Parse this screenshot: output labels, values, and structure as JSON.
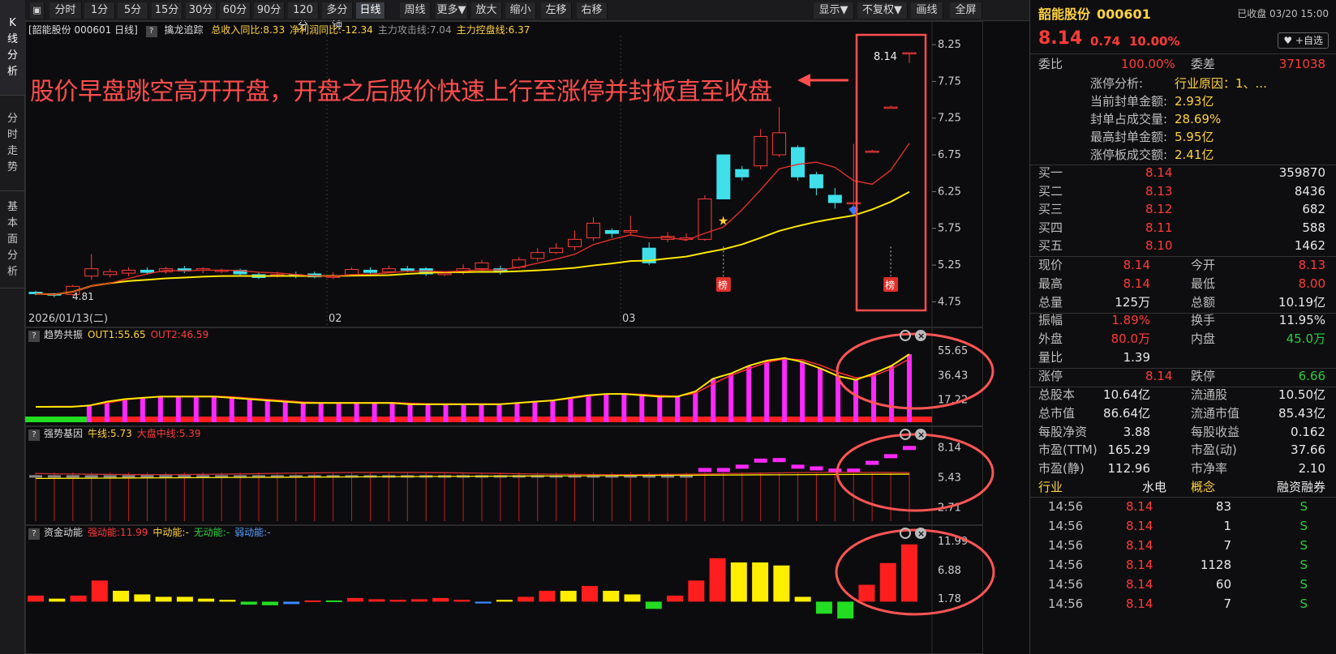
{
  "nav": {
    "kline": "K线分析",
    "fenshi": "分时走势",
    "jiben": "基本面分析"
  },
  "toolbar": {
    "periods": [
      "分时",
      "1分",
      "5分",
      "15分",
      "30分",
      "60分",
      "90分",
      "120分",
      "多分钟",
      "日线",
      "周线",
      "更多▼",
      "放大",
      "缩小",
      "左移",
      "右移"
    ],
    "active": "日线",
    "right": [
      "显示▼",
      "不复权▼",
      "画线",
      "全屏"
    ]
  },
  "kchart": {
    "stock": "[韶能股份 000601 日线]",
    "indicator": "擒龙追踪",
    "vals": [
      {
        "t": "总收入同比:8.33",
        "c": "#ffd23f"
      },
      {
        "t": "净利润同比:-12.34",
        "c": "#ffd23f"
      },
      {
        "t": "主力攻击线:7.04",
        "c": "#9a9a9a"
      },
      {
        "t": "主力控盘线:6.37",
        "c": "#ffd23f"
      }
    ],
    "annotation": "股价早盘跳空高开开盘，开盘之后股价快速上行至涨停并封板直至收盘",
    "last_price": "8.14",
    "low_label": "4.81",
    "bang": "榜",
    "y_ticks": [
      "8.25",
      "7.75",
      "7.25",
      "6.75",
      "6.25",
      "5.75",
      "5.25",
      "4.75"
    ],
    "x_labels": [
      "2026/01/13(二)",
      "02",
      "03"
    ]
  },
  "panel1": {
    "name": "趋势共振",
    "vals": [
      {
        "t": "OUT1:55.65",
        "c": "#ffd23f"
      },
      {
        "t": "OUT2:46.59",
        "c": "#ff3b3b"
      }
    ],
    "y_ticks": [
      "55.65",
      "36.43",
      "17.22"
    ]
  },
  "panel2": {
    "name": "强势基因",
    "vals": [
      {
        "t": "牛线:5.73",
        "c": "#ffd23f"
      },
      {
        "t": "大盘中线:5.39",
        "c": "#ff3b3b"
      }
    ],
    "y_ticks": [
      "8.14",
      "5.43",
      "2.71"
    ]
  },
  "panel3": {
    "name": "资金动能",
    "vals": [
      {
        "t": "强动能:11.99",
        "c": "#ff3b3b"
      },
      {
        "t": "中动能:-",
        "c": "#ffd23f"
      },
      {
        "t": "无动能:-",
        "c": "#2ecc40"
      },
      {
        "t": "弱动能:-",
        "c": "#5aa0ff"
      }
    ],
    "y_ticks": [
      "11.99",
      "6.88",
      "1.78"
    ]
  },
  "side": {
    "name": "韶能股份",
    "code": "000601",
    "status": "已收盘 03/20 15:00",
    "price": "8.14",
    "change": "0.74",
    "pct": "10.00%",
    "fav": "♥ +自选",
    "weibi": {
      "label": "委比",
      "value": "100.00%",
      "label2": "委差",
      "value2": "371038"
    },
    "limit_info": [
      {
        "k": "涨停分析:",
        "v": "行业原因：1、..."
      },
      {
        "k": "当前封单金额:",
        "v": "2.93亿"
      },
      {
        "k": "封单占成交量:",
        "v": "28.69%"
      },
      {
        "k": "最高封单金额:",
        "v": "5.95亿"
      },
      {
        "k": "涨停板成交额:",
        "v": "2.41亿"
      }
    ],
    "buy": [
      {
        "l": "买一",
        "p": "8.14",
        "v": "359870"
      },
      {
        "l": "买二",
        "p": "8.13",
        "v": "8436"
      },
      {
        "l": "买三",
        "p": "8.12",
        "v": "682"
      },
      {
        "l": "买四",
        "p": "8.11",
        "v": "588"
      },
      {
        "l": "买五",
        "p": "8.10",
        "v": "1462"
      }
    ],
    "quote": [
      {
        "a": "现价",
        "b": "8.14",
        "bc": "red",
        "c": "今开",
        "d": "8.13",
        "dc": "red"
      },
      {
        "a": "最高",
        "b": "8.14",
        "bc": "red",
        "c": "最低",
        "d": "8.00",
        "dc": "red"
      },
      {
        "a": "总量",
        "b": "125万",
        "bc": "wht",
        "c": "总额",
        "d": "10.19亿",
        "dc": "wht"
      }
    ],
    "quote2": [
      {
        "a": "振幅",
        "b": "1.89%",
        "bc": "red",
        "c": "换手",
        "d": "11.95%",
        "dc": "wht"
      },
      {
        "a": "外盘",
        "b": "80.0万",
        "bc": "red",
        "c": "内盘",
        "d": "45.0万",
        "dc": "grn"
      },
      {
        "a": "量比",
        "b": "1.39",
        "bc": "wht",
        "c": "",
        "d": "",
        "dc": "wht"
      }
    ],
    "limit": {
      "a": "涨停",
      "b": "8.14",
      "c": "跌停",
      "d": "6.66"
    },
    "fund": [
      {
        "a": "总股本",
        "b": "10.64亿",
        "c": "流通股",
        "d": "10.50亿"
      },
      {
        "a": "总市值",
        "b": "86.64亿",
        "c": "流通市值",
        "d": "85.43亿"
      },
      {
        "a": "每股净资",
        "b": "3.88",
        "c": "每股收益",
        "d": "0.162"
      },
      {
        "a": "市盈(TTM)",
        "b": "165.29",
        "c": "市盈(动)",
        "d": "37.66"
      },
      {
        "a": "市盈(静)",
        "b": "112.96",
        "c": "市净率",
        "d": "2.10"
      }
    ],
    "industry": {
      "a": "行业",
      "b": "水电",
      "c": "概念",
      "d": "融资融券"
    },
    "ticks": [
      {
        "t": "14:56",
        "p": "8.14",
        "v": "83",
        "s": "S"
      },
      {
        "t": "14:56",
        "p": "8.14",
        "v": "1",
        "s": "S"
      },
      {
        "t": "14:56",
        "p": "8.14",
        "v": "7",
        "s": "S"
      },
      {
        "t": "14:56",
        "p": "8.14",
        "v": "1128",
        "s": "S"
      },
      {
        "t": "14:56",
        "p": "8.14",
        "v": "60",
        "s": "S"
      },
      {
        "t": "14:56",
        "p": "8.14",
        "v": "7",
        "s": "S"
      }
    ]
  },
  "chart_data": {
    "type": "candlestick",
    "title": "韶能股份 000601 日线",
    "dates_start": "2026/01/13",
    "candles": [
      [
        4.88,
        4.86,
        4.9,
        4.84
      ],
      [
        4.86,
        4.84,
        4.87,
        4.81
      ],
      [
        4.85,
        4.96,
        4.98,
        4.83
      ],
      [
        5.1,
        5.2,
        5.4,
        5.05
      ],
      [
        5.12,
        5.16,
        5.2,
        5.08
      ],
      [
        5.14,
        5.18,
        5.22,
        5.1
      ],
      [
        5.18,
        5.15,
        5.22,
        5.12
      ],
      [
        5.16,
        5.2,
        5.23,
        5.13
      ],
      [
        5.2,
        5.17,
        5.24,
        5.14
      ],
      [
        5.18,
        5.2,
        5.22,
        5.14
      ],
      [
        5.17,
        5.18,
        5.2,
        5.14
      ],
      [
        5.18,
        5.13,
        5.2,
        5.11
      ],
      [
        5.12,
        5.08,
        5.15,
        5.06
      ],
      [
        5.1,
        5.12,
        5.16,
        5.08
      ],
      [
        5.12,
        5.1,
        5.16,
        5.07
      ],
      [
        5.13,
        5.09,
        5.16,
        5.07
      ],
      [
        5.09,
        5.1,
        5.15,
        5.06
      ],
      [
        5.12,
        5.19,
        5.22,
        5.1
      ],
      [
        5.18,
        5.15,
        5.22,
        5.12
      ],
      [
        5.16,
        5.2,
        5.24,
        5.14
      ],
      [
        5.2,
        5.18,
        5.24,
        5.15
      ],
      [
        5.2,
        5.13,
        5.22,
        5.1
      ],
      [
        5.12,
        5.14,
        5.17,
        5.1
      ],
      [
        5.15,
        5.2,
        5.26,
        5.12
      ],
      [
        5.2,
        5.28,
        5.32,
        5.17
      ],
      [
        5.2,
        5.16,
        5.24,
        5.12
      ],
      [
        5.22,
        5.32,
        5.36,
        5.2
      ],
      [
        5.34,
        5.42,
        5.48,
        5.3
      ],
      [
        5.42,
        5.48,
        5.55,
        5.4
      ],
      [
        5.5,
        5.6,
        5.72,
        5.45
      ],
      [
        5.62,
        5.82,
        5.9,
        5.58
      ],
      [
        5.72,
        5.68,
        5.75,
        5.62
      ],
      [
        5.7,
        5.72,
        5.92,
        5.66
      ],
      [
        5.48,
        5.28,
        5.56,
        5.25
      ],
      [
        5.6,
        5.64,
        5.7,
        5.56
      ],
      [
        5.6,
        5.62,
        5.68,
        5.58
      ],
      [
        5.6,
        6.15,
        6.2,
        5.58
      ],
      [
        6.75,
        6.15,
        6.75,
        6.15
      ],
      [
        6.55,
        6.45,
        6.6,
        6.4
      ],
      [
        6.6,
        7.0,
        7.1,
        6.55
      ],
      [
        6.75,
        7.05,
        7.4,
        6.72
      ],
      [
        6.85,
        6.45,
        6.88,
        6.4
      ],
      [
        6.48,
        6.3,
        6.52,
        6.2
      ],
      [
        6.2,
        6.1,
        6.3,
        6.02
      ],
      [
        6.1,
        6.1,
        6.9,
        6.05
      ],
      [
        6.8,
        6.8,
        6.82,
        6.78
      ],
      [
        7.4,
        7.4,
        7.42,
        7.38
      ],
      [
        8.13,
        8.14,
        8.14,
        8.0
      ]
    ],
    "ma_yellow_end": 6.37,
    "ma_red_end": 7.04
  }
}
